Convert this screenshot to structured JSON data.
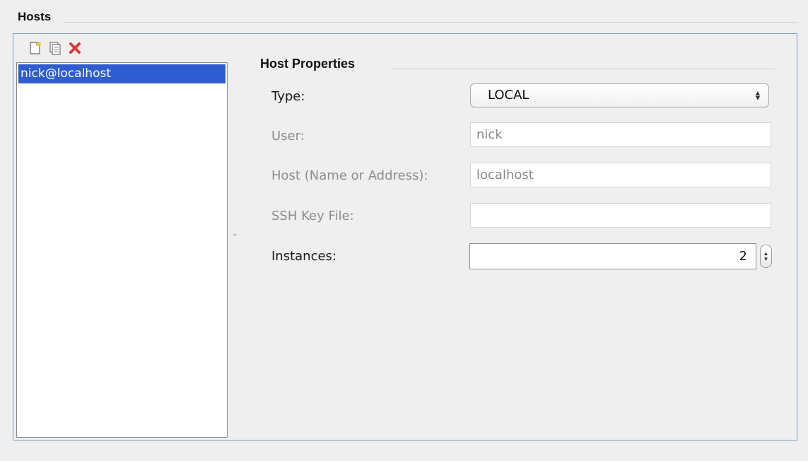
{
  "hosts": {
    "title": "Hosts",
    "toolbar": [
      {
        "name": "new-icon"
      },
      {
        "name": "copy-icon"
      },
      {
        "name": "delete-icon"
      }
    ],
    "list": [
      "nick@localhost"
    ],
    "selected_index": 0
  },
  "properties": {
    "title": "Host Properties",
    "type_label": "Type:",
    "type_value": "LOCAL",
    "user_label": "User:",
    "user_value": "nick",
    "host_label": "Host (Name or Address):",
    "host_value": "localhost",
    "ssh_label": "SSH Key File:",
    "ssh_value": "",
    "instances_label": "Instances:",
    "instances_value": "2"
  },
  "colors": {
    "selection": "#2f5dcf",
    "frame_border": "#7d9cc6",
    "delete_icon": "#d93a3a"
  }
}
